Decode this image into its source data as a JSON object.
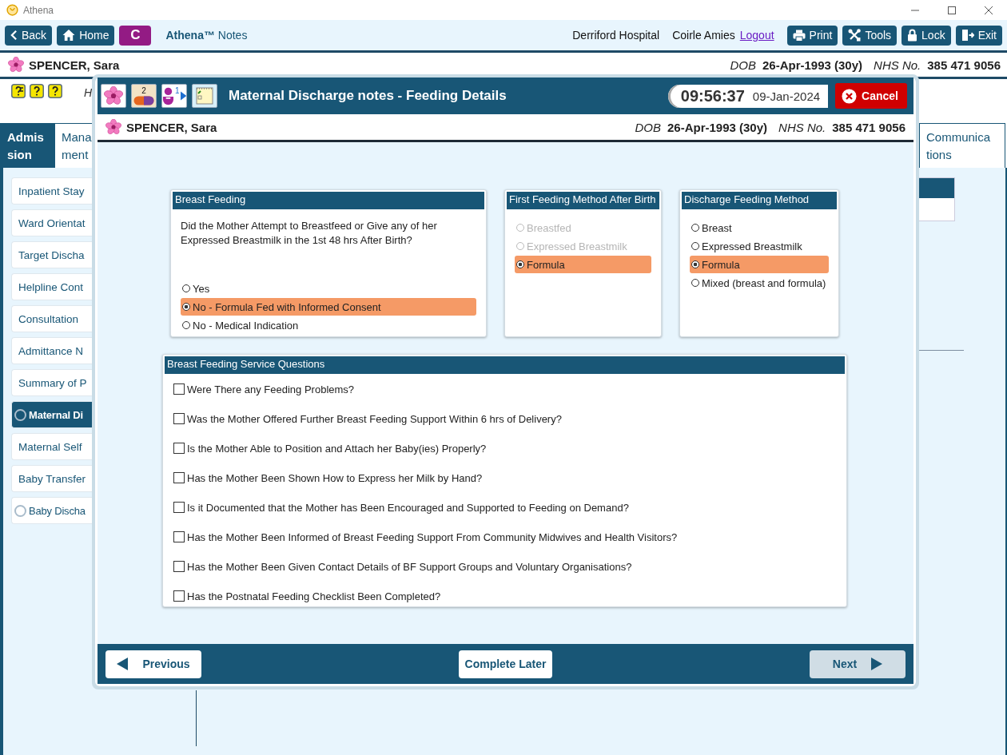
{
  "window": {
    "title": "Athena"
  },
  "toolbar": {
    "buttons_left": [
      {
        "kind": "back",
        "label": "Back"
      },
      {
        "kind": "home",
        "label": "Home"
      },
      {
        "kind": "letter",
        "label": "C"
      }
    ],
    "app_name": "Athena™",
    "app_section": "Notes",
    "location": "Derriford Hospital",
    "user": "Coirle Amies",
    "logout": "Logout",
    "buttons_right": [
      {
        "kind": "print",
        "label": "Print"
      },
      {
        "kind": "tools",
        "label": "Tools"
      },
      {
        "kind": "lock",
        "label": "Lock"
      },
      {
        "kind": "exit",
        "label": "Exit"
      }
    ]
  },
  "patient": {
    "name": "SPENCER, Sara",
    "dob_label": "DOB",
    "dob": "26-Apr-1993 (30y)",
    "nhs_label": "NHS No.",
    "nhs": "385 471 9056"
  },
  "header_note": "H",
  "tabs": [
    {
      "lines": [
        "Admis",
        "sion"
      ],
      "selected": true
    },
    {
      "lines": [
        "Mana",
        "ment"
      ],
      "selected": false
    },
    {
      "lines": [
        "Communica",
        "tions"
      ],
      "selected": false
    }
  ],
  "sidebar": {
    "items": [
      {
        "label": "Inpatient Stay",
        "kind": "plain",
        "selected": false
      },
      {
        "label": "Ward Orientat",
        "kind": "plain",
        "selected": false
      },
      {
        "label": "Target Discha",
        "kind": "plain",
        "selected": false
      },
      {
        "label": "Helpline Cont",
        "kind": "plain",
        "selected": false
      },
      {
        "label": "Consultation",
        "kind": "plain",
        "selected": false
      },
      {
        "label": "Admittance N",
        "kind": "plain",
        "selected": false
      },
      {
        "label": "Summary of P",
        "kind": "plain",
        "selected": false
      },
      {
        "label": "Maternal Di",
        "kind": "radio",
        "selected": true
      },
      {
        "label": "Maternal Self",
        "kind": "plain",
        "selected": false
      },
      {
        "label": "Baby Transfer",
        "kind": "plain",
        "selected": false
      },
      {
        "label": "Baby Discha",
        "kind": "radio",
        "selected": false
      }
    ]
  },
  "modal": {
    "header_icons": [
      {
        "kind": "flower"
      },
      {
        "kind": "pills",
        "badge": "2"
      },
      {
        "kind": "person",
        "badge": "1"
      },
      {
        "kind": "notepad"
      }
    ],
    "title": "Maternal Discharge notes - Feeding Details",
    "time": "09:56:37",
    "date": "09-Jan-2024",
    "cancel": "Cancel",
    "patient": {
      "name": "SPENCER, Sara",
      "dob_label": "DOB",
      "dob": "26-Apr-1993 (30y)",
      "nhs_label": "NHS No.",
      "nhs": "385 471 9056"
    },
    "groups": [
      {
        "kind": "question",
        "title": "Breast Feeding",
        "question": "Did the Mother Attempt to Breastfeed or Give any of her Expressed Breastmilk in the 1st 48 hrs After Birth?",
        "options": [
          {
            "label": "Yes",
            "selected": false,
            "disabled": false
          },
          {
            "label": "No - Formula Fed with Informed Consent",
            "selected": true,
            "disabled": false
          },
          {
            "label": "No - Medical Indication",
            "selected": false,
            "disabled": false
          }
        ]
      },
      {
        "kind": "choice",
        "title": "First Feeding Method After Birth",
        "options": [
          {
            "label": "Breastfed",
            "selected": false,
            "disabled": true
          },
          {
            "label": "Expressed Breastmilk",
            "selected": false,
            "disabled": true
          },
          {
            "label": "Formula",
            "selected": true,
            "disabled": false
          }
        ]
      },
      {
        "kind": "choice",
        "title": "Discharge Feeding Method",
        "options": [
          {
            "label": "Breast",
            "selected": false,
            "disabled": false
          },
          {
            "label": "Expressed Breastmilk",
            "selected": false,
            "disabled": false
          },
          {
            "label": "Formula",
            "selected": true,
            "disabled": false
          },
          {
            "label": "Mixed (breast and formula)",
            "selected": false,
            "disabled": false
          }
        ]
      }
    ],
    "service": {
      "title": "Breast Feeding Service Questions",
      "questions": [
        {
          "label": "Were There any Feeding Problems?",
          "checked": false
        },
        {
          "label": "Was the Mother Offered Further Breast Feeding Support Within 6 hrs of Delivery?",
          "checked": false
        },
        {
          "label": "Is the Mother Able to Position and Attach her Baby(ies) Properly?",
          "checked": false
        },
        {
          "label": "Has the Mother Been Shown How to Express her Milk by Hand?",
          "checked": false
        },
        {
          "label": "Is it Documented that the Mother has Been Encouraged and Supported to Feeding on Demand?",
          "checked": false
        },
        {
          "label": "Has the Mother Been Informed of Breast Feeding Support From Community Midwives and Health Visitors?",
          "checked": false
        },
        {
          "label": "Has the Mother Been Given Contact Details of BF Support Groups and Voluntary Organisations?",
          "checked": false
        },
        {
          "label": "Has the Postnatal Feeding Checklist Been Completed?",
          "checked": false
        }
      ]
    },
    "footer": [
      {
        "kind": "previous",
        "label": "Previous",
        "disabled": false
      },
      {
        "kind": "plain",
        "label": "Complete Later",
        "disabled": false
      },
      {
        "kind": "next",
        "label": "Next",
        "disabled": true
      }
    ]
  }
}
